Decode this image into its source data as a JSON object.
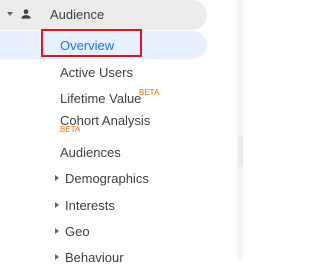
{
  "nav": {
    "section": {
      "label": "Audience",
      "icon": "person-icon",
      "expanded": true
    },
    "items": [
      {
        "label": "Overview",
        "active": true
      },
      {
        "label": "Active Users"
      },
      {
        "label": "Lifetime Value",
        "badge": "BETA"
      },
      {
        "label": "Cohort Analysis",
        "badge": "BETA"
      },
      {
        "label": "Audiences"
      },
      {
        "label": "Demographics",
        "expandable": true
      },
      {
        "label": "Interests",
        "expandable": true
      },
      {
        "label": "Geo",
        "expandable": true
      },
      {
        "label": "Behaviour",
        "expandable": true
      }
    ]
  },
  "colors": {
    "active_text": "#1a73e8",
    "active_background": "#e8f0fe",
    "beta_badge": "#e8710a",
    "highlight_box": "#e0151f"
  }
}
